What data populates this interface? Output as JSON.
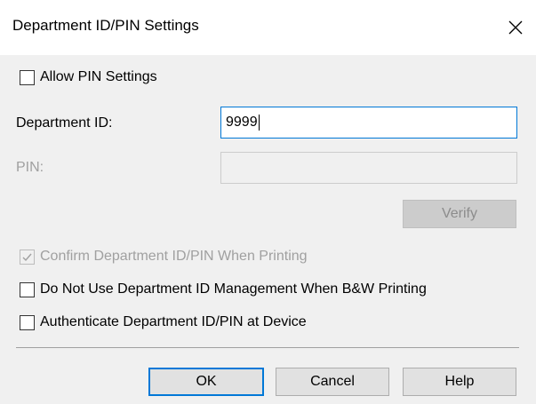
{
  "dialog": {
    "title": "Department ID/PIN Settings"
  },
  "allow_pin": {
    "label": "Allow PIN Settings",
    "checked": false
  },
  "department_id": {
    "label": "Department ID:",
    "value": "9999"
  },
  "pin": {
    "label": "PIN:",
    "value": ""
  },
  "verify_button": {
    "label": "Verify"
  },
  "options": {
    "confirm": {
      "label": "Confirm Department ID/PIN When Printing",
      "checked": true,
      "enabled": false
    },
    "no_bw_management": {
      "label": "Do Not Use Department ID Management When B&W Printing",
      "checked": false
    },
    "authenticate_device": {
      "label": "Authenticate Department ID/PIN at Device",
      "checked": false
    }
  },
  "footer": {
    "ok_label": "OK",
    "cancel_label": "Cancel",
    "help_label": "Help"
  },
  "colors": {
    "accent": "#0078d7",
    "disabled_text": "#a0a0a0"
  },
  "icons": {
    "close": "close-icon",
    "check": "checkmark-icon"
  }
}
